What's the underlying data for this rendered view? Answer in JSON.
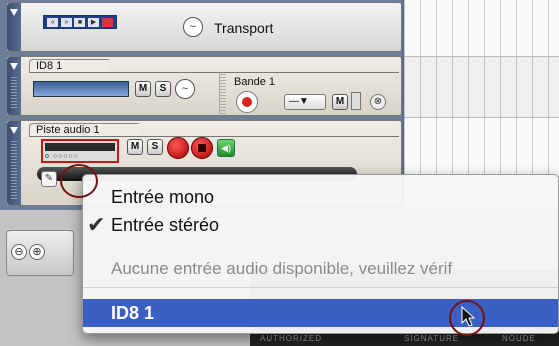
{
  "transport_track": {
    "name": "Transport",
    "controls": [
      "«",
      "»",
      "■",
      "▶",
      "●"
    ]
  },
  "id8_track": {
    "name": "ID8 1",
    "mute": "M",
    "solo": "S",
    "bande": {
      "label": "Bande 1",
      "dropdown_value": "—▼",
      "mute": "M",
      "close": "⊗"
    }
  },
  "audio_track": {
    "name": "Piste audio 1",
    "mute": "M",
    "solo": "S",
    "device_knobs": "o ○○○○○"
  },
  "menu": {
    "items": [
      {
        "label": "Entrée mono",
        "checked": false,
        "enabled": true
      },
      {
        "label": "Entrée stéréo",
        "checked": true,
        "enabled": true
      },
      {
        "label": "Aucune entrée audio disponible, veuillez vérif",
        "checked": false,
        "enabled": false
      },
      {
        "label": "ID8 1",
        "checked": false,
        "enabled": true,
        "highlighted": true
      }
    ],
    "check_mark": "✔"
  },
  "zoom": {
    "zoom_out": "⊖",
    "zoom_in": "⊕"
  },
  "rack_labels": [
    "AUTHORIZED",
    "SIGNATURE",
    "NOUDE"
  ],
  "colors": {
    "selection": "#3a60c4",
    "record_red": "#e02020",
    "annotation_circle": "#7a1111"
  }
}
